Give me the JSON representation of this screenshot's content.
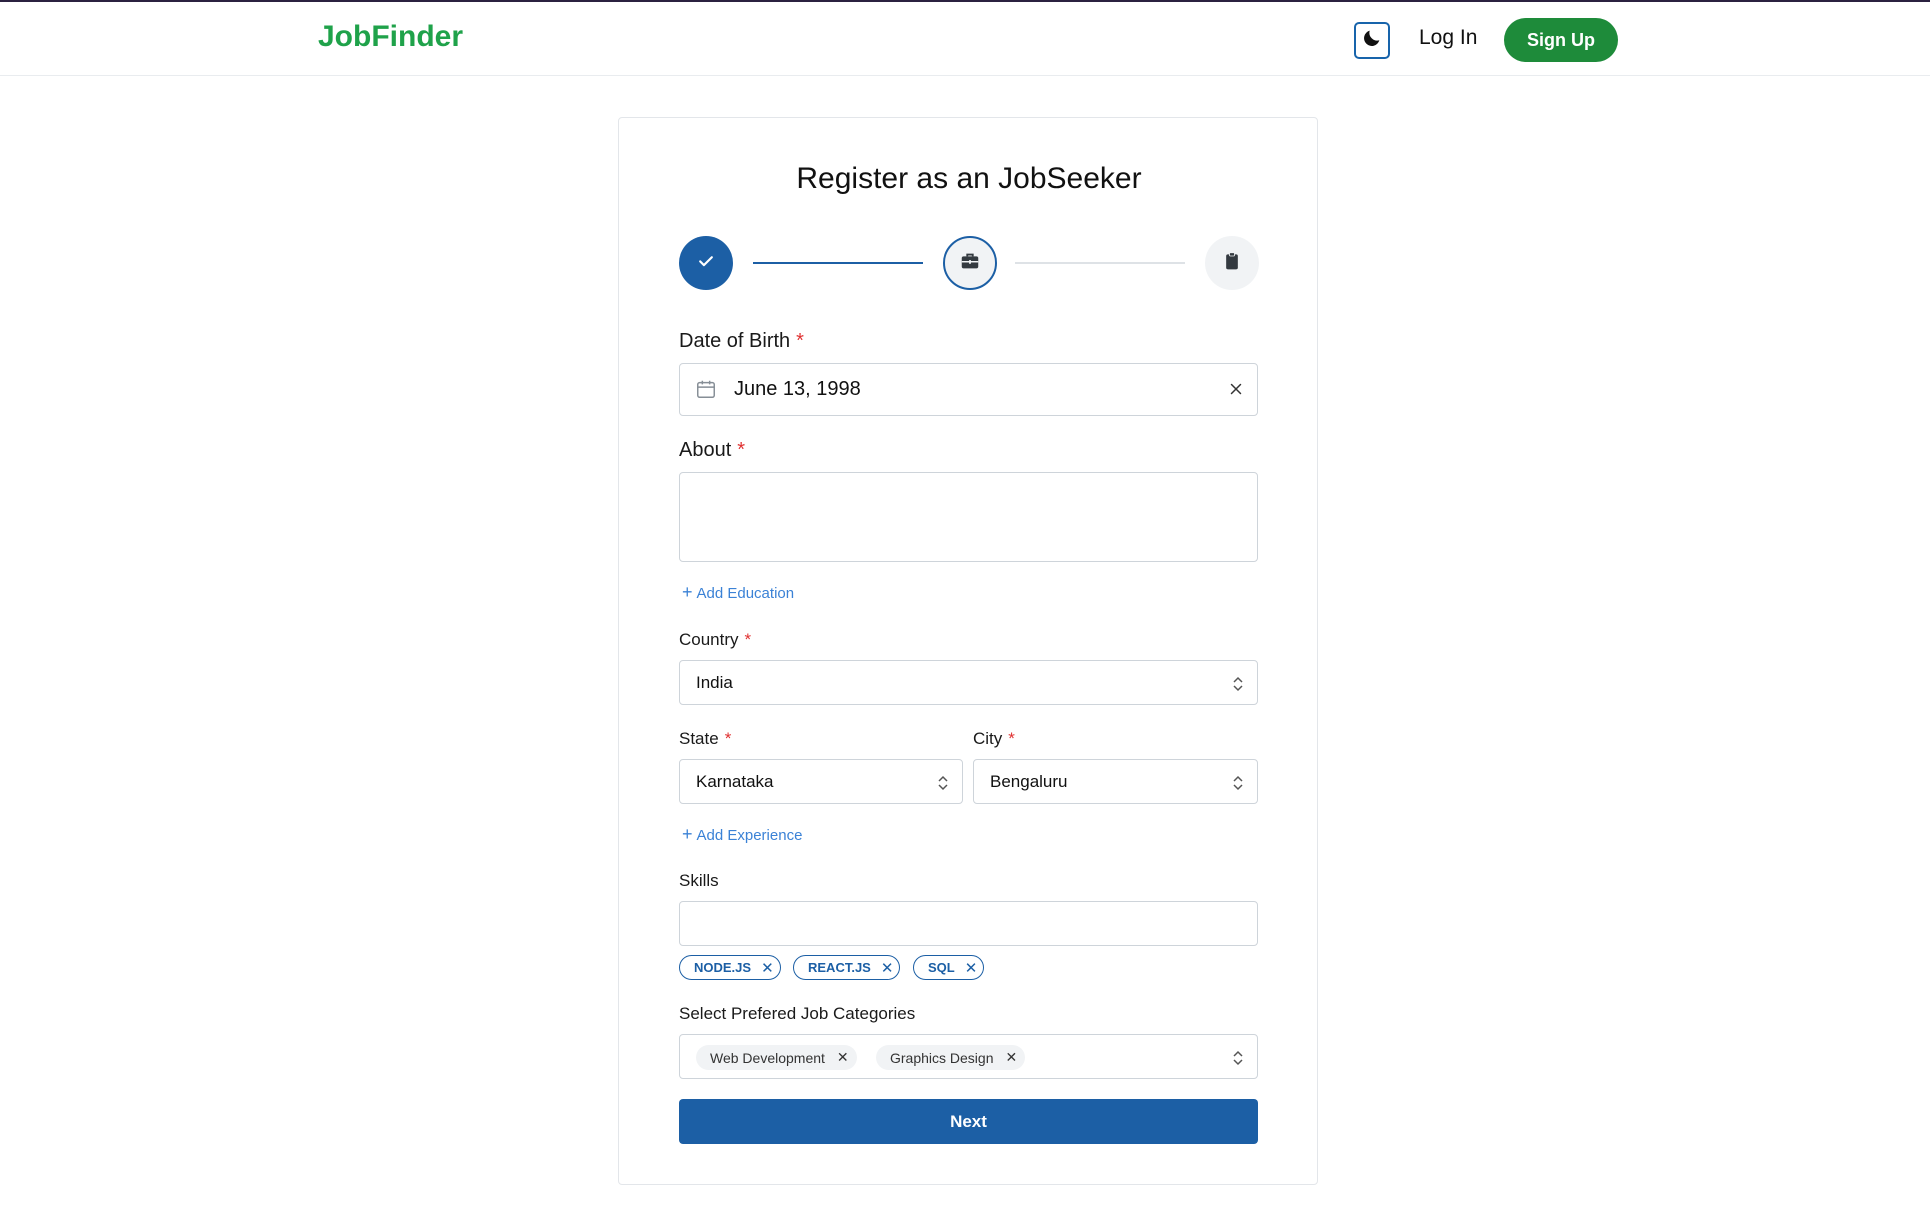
{
  "header": {
    "logo": "JobFinder",
    "login_label": "Log In",
    "signup_label": "Sign Up",
    "theme_icon": "moon-icon"
  },
  "form": {
    "title": "Register as an JobSeeker",
    "steps": [
      {
        "icon": "check-icon",
        "state": "completed"
      },
      {
        "icon": "briefcase-icon",
        "state": "active"
      },
      {
        "icon": "clipboard-icon",
        "state": "pending"
      }
    ],
    "dob": {
      "label": "Date of Birth",
      "required_mark": "*",
      "value": "June 13, 1998"
    },
    "about": {
      "label": "About",
      "required_mark": "*",
      "value": ""
    },
    "add_education": "Add Education",
    "country": {
      "label": "Country",
      "required_mark": "*",
      "value": "India"
    },
    "state": {
      "label": "State",
      "required_mark": "*",
      "value": "Karnataka"
    },
    "city": {
      "label": "City",
      "required_mark": "*",
      "value": "Bengaluru"
    },
    "add_experience": "Add Experience",
    "skills": {
      "label": "Skills",
      "value": "",
      "tags": [
        "NODE.JS",
        "REACT.JS",
        "SQL"
      ]
    },
    "categories": {
      "label": "Select Prefered Job Categories",
      "selected": [
        "Web Development",
        "Graphics Design"
      ]
    },
    "next_label": "Next"
  },
  "colors": {
    "brand_green": "#1fa24a",
    "signup_green": "#1e8b3a",
    "primary_blue": "#1c5fa5",
    "link_blue": "#3b82d6",
    "required_red": "#e03131"
  }
}
